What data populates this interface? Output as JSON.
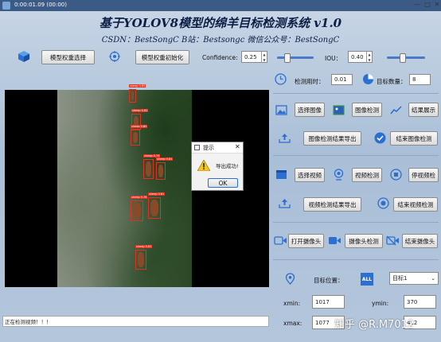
{
  "window": {
    "title": "0:00:01.09 (00:00)"
  },
  "header": {
    "title": "基于YOLOV8模型的绵羊目标检测系统 v1.0",
    "subtitle": "CSDN：BestSongC   B站：Bestsongc   微信公众号：BestSongC"
  },
  "toolbar": {
    "model_select_label": "模型权重选择",
    "model_init_label": "模型权重初始化",
    "confidence_label": "Confidence:",
    "confidence_value": "0.25",
    "confidence_slider": 0.25,
    "iou_label": "IOU：",
    "iou_value": "0.40",
    "iou_slider": 0.4
  },
  "stats": {
    "time_label": "检测用时：",
    "time_value": "0.01",
    "count_label": "目标数量：",
    "count_value": "8"
  },
  "image_section": {
    "select_label": "选择图像",
    "detect_label": "图像检测",
    "show_label": "结果展示",
    "export_label": "图像检测结果导出",
    "end_label": "结束图像检测"
  },
  "video_section": {
    "select_label": "选择视频",
    "detect_label": "视频检测",
    "pause_label": "停视频检",
    "export_label": "视频检测结果导出",
    "end_label": "结束视频检测"
  },
  "camera_section": {
    "open_label": "打开摄像头",
    "detect_label": "摄像头检测",
    "end_label": "结束摄像头"
  },
  "position": {
    "label": "目标位置：",
    "target_select": "目标1",
    "xmin_label": "xmin:",
    "xmin_value": "1017",
    "ymin_label": "ymin:",
    "ymin_value": "370",
    "xmax_label": "xmax:",
    "xmax_value": "1077",
    "ymax_value": "412"
  },
  "dialog": {
    "title": "提示",
    "message": "导出成功!",
    "ok_label": "OK"
  },
  "status": {
    "text": "正在检测视频！！！"
  },
  "detections": {
    "tags": [
      "sheep 0.85",
      "sheep 0.82",
      "sheep 0.80",
      "sheep 0.79",
      "sheep 0.84",
      "sheep 0.78",
      "sheep 0.81",
      "sheep 0.83"
    ]
  },
  "watermark": {
    "text": "知乎 @R.M7012"
  },
  "colors": {
    "accent": "#2a6fd1",
    "detection": "#e2321f",
    "title": "#0b1f45"
  }
}
